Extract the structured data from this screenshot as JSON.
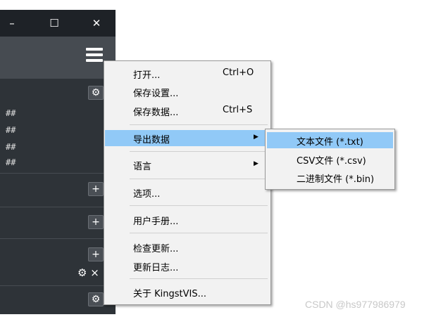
{
  "window": {
    "minimize_glyph": "–",
    "maximize_glyph": "☐",
    "close_glyph": "✕",
    "menu_icon": "hamburger-menu-icon"
  },
  "channels": {
    "hash_lines": [
      "##",
      "##",
      "##",
      "##"
    ],
    "gear_glyph": "⚙",
    "plus_glyph": "+",
    "gear_close_glyph": "⚙ ×"
  },
  "menu": {
    "items": [
      {
        "label": "打开...",
        "shortcut": "Ctrl+O"
      },
      {
        "label": "保存设置...",
        "shortcut": ""
      },
      {
        "label": "保存数据...",
        "shortcut": "Ctrl+S"
      },
      {
        "label": "导出数据",
        "shortcut": "",
        "submenu": true,
        "highlighted": true
      },
      {
        "label": "语言",
        "shortcut": "",
        "submenu": true
      },
      {
        "label": "选项...",
        "shortcut": ""
      },
      {
        "label": "用户手册...",
        "shortcut": ""
      },
      {
        "label": "检查更新...",
        "shortcut": ""
      },
      {
        "label": "更新日志...",
        "shortcut": ""
      },
      {
        "label": "关于 KingstVIS...",
        "shortcut": ""
      }
    ],
    "arrow_glyph": "▶"
  },
  "submenu": {
    "items": [
      {
        "label": "文本文件 (*.txt)",
        "highlighted": true
      },
      {
        "label": "CSV文件 (*.csv)"
      },
      {
        "label": "二进制文件 (*.bin)"
      }
    ]
  },
  "watermark": "CSDN @hs977986979",
  "colors": {
    "highlight": "#91c9f7",
    "menu_bg": "#f2f2f2",
    "app_bg": "#2e3338"
  }
}
